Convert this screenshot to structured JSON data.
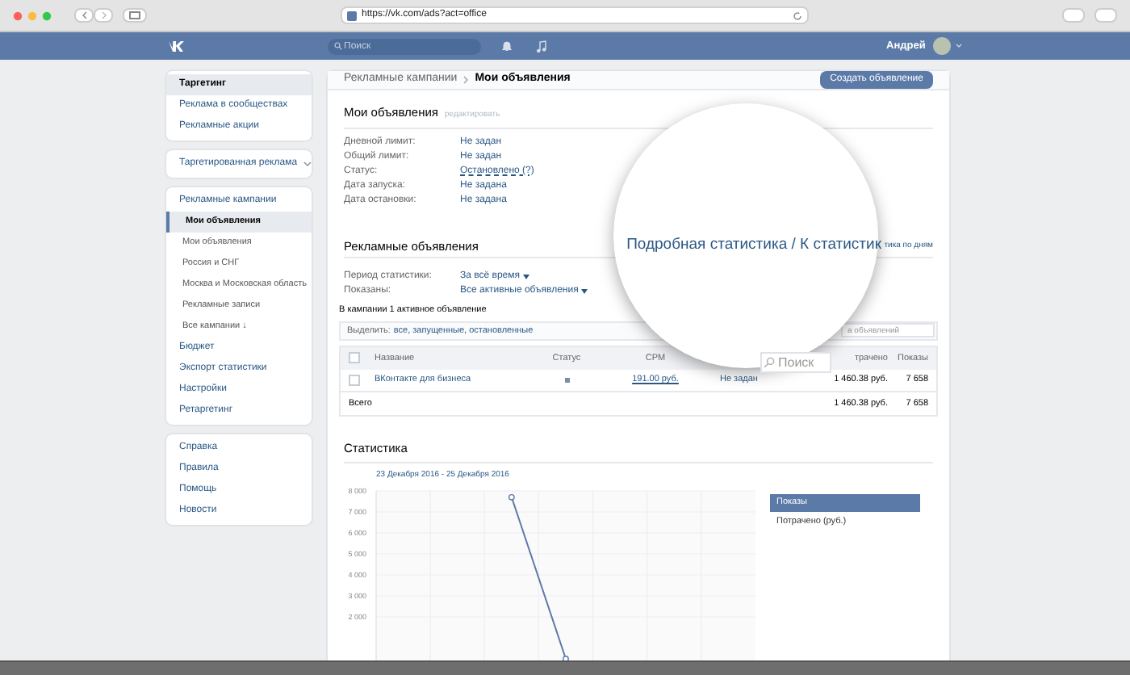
{
  "browser": {
    "url": "https://vk.com/ads?act=office"
  },
  "header": {
    "search": {
      "placeholder": "Поиск"
    },
    "user": "Андрей"
  },
  "sidebar": {
    "groups": [
      {
        "items": [
          {
            "label": "Таргетинг",
            "selected": true
          },
          {
            "label": "Реклама в сообществах",
            "selected": false
          },
          {
            "label": "Рекламные акции",
            "selected": false
          }
        ]
      },
      {
        "items": [
          {
            "label": "Таргетированная реклама",
            "selected": false,
            "kind": "dropdown"
          }
        ]
      },
      {
        "items": [
          {
            "label": "Рекламные кампании",
            "selected": false,
            "children": [
              {
                "label": "Мои объявления",
                "selected": true
              },
              {
                "label": "Мои объявления",
                "selected": false
              },
              {
                "label": "Россия и СНГ",
                "selected": false
              },
              {
                "label": "Москва и Московская область",
                "selected": false
              },
              {
                "label": "Рекламные записи",
                "selected": false
              },
              {
                "label": "Все кампании ↓",
                "selected": false
              }
            ]
          },
          {
            "label": "Бюджет",
            "selected": false
          },
          {
            "label": "Экспорт статистики",
            "selected": false
          },
          {
            "label": "Настройки",
            "selected": false
          },
          {
            "label": "Ретаргетинг",
            "selected": false
          }
        ]
      },
      {
        "items": [
          {
            "label": "Справка",
            "selected": false
          },
          {
            "label": "Правила",
            "selected": false
          },
          {
            "label": "Помощь",
            "selected": false
          },
          {
            "label": "Новости",
            "selected": false
          }
        ]
      }
    ]
  },
  "breadcrumb": [
    "Рекламные кампании",
    "Мои объявления"
  ],
  "create_button": "Создать объявление",
  "campaign": {
    "title": "Мои объявления",
    "edit_link": "редактировать",
    "fields": [
      {
        "label": "Дневной лимит:",
        "value": "Не задан",
        "kind": "link"
      },
      {
        "label": "Общий лимит:",
        "value": "Не задан",
        "kind": "link"
      },
      {
        "label": "Статус:",
        "value": "Остановлено (?)",
        "kind": "status"
      },
      {
        "label": "Дата запуска:",
        "value": "Не задана",
        "kind": "link"
      },
      {
        "label": "Дата остановки:",
        "value": "Не задана",
        "kind": "link"
      }
    ]
  },
  "ads": {
    "title": "Рекламные объявления",
    "stats_link": "тика по дням",
    "filters": [
      {
        "label": "Период статистики:",
        "value": "За всё время"
      },
      {
        "label": "Показаны:",
        "value": "Все активные объявления"
      }
    ],
    "summary": "В кампании 1 активное объявление",
    "select_label": "Выделить:",
    "select_options": "все, запущенные, остановленные",
    "search": {
      "placeholder": "а объявлений"
    },
    "table": {
      "header": {
        "checked": false,
        "name": "Название",
        "status": "Статус",
        "cpm": "CPM",
        "spent": "трачено",
        "impressions": "Показы"
      },
      "rows": [
        {
          "checked": false,
          "name": "ВКонтакте для бизнеса",
          "cpm": "191.00 руб.",
          "column_5": "Не задан",
          "spent": "1 460.38 руб.",
          "impressions": "7 658"
        }
      ],
      "total": {
        "label": "Всего",
        "spent": "1 460.38 руб.",
        "impressions": "7 658"
      }
    }
  },
  "magnifier": {
    "text": "Подробная статистика / К статистик",
    "search": {
      "placeholder": "Поиск"
    }
  },
  "stats": {
    "title": "Статистика",
    "date_range": "23 Декабря 2016 - 25 Декабря 2016",
    "chart_data": {
      "type": "line",
      "grid": true,
      "categories": [
        null,
        null,
        null,
        null,
        null,
        null,
        null
      ],
      "ylim": [
        0,
        8000
      ],
      "yticks": [
        {
          "value": 2000,
          "label": "2 000"
        },
        {
          "value": 3000,
          "label": "3 000"
        },
        {
          "value": 4000,
          "label": "4 000"
        },
        {
          "value": 5000,
          "label": "5 000"
        },
        {
          "value": 6000,
          "label": "6 000"
        },
        {
          "value": 7000,
          "label": "7 000"
        },
        {
          "value": 8000,
          "label": "8 000"
        }
      ],
      "series": [
        {
          "marker": "o",
          "values": [
            null,
            null,
            7700,
            0,
            null,
            null,
            null
          ]
        }
      ]
    },
    "legend": [
      {
        "label": "Показы",
        "selected": true
      },
      {
        "label": "Потрачено (руб.)",
        "selected": false
      }
    ]
  }
}
